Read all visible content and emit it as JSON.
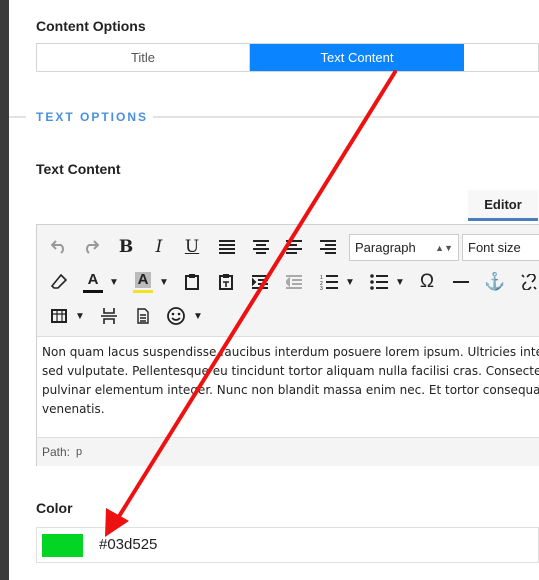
{
  "content_options": {
    "label": "Content Options",
    "segments": [
      "Title",
      "Text Content"
    ],
    "active": "Text Content"
  },
  "text_options": {
    "label": "TEXT OPTIONS"
  },
  "text_content": {
    "label": "Text Content",
    "tab": "Editor",
    "toolbar": {
      "paragraph": "Paragraph",
      "font_size": "Font size",
      "bold": "B",
      "italic": "I",
      "underline": "U"
    },
    "body_lines": [
      "Non quam lacus suspendisse faucibus interdum posuere lorem ipsum. Ultricies intege",
      "sed vulputate. Pellentesque eu tincidunt tortor aliquam nulla facilisi cras. Consectetur p",
      "pulvinar elementum integer. Nunc non blandit massa enim nec. Et tortor consequat id",
      "venenatis."
    ],
    "path_label": "Path:",
    "path_value": "p"
  },
  "color": {
    "label": "Color",
    "value": "#03d525"
  },
  "annotation_color": "#ee1111"
}
